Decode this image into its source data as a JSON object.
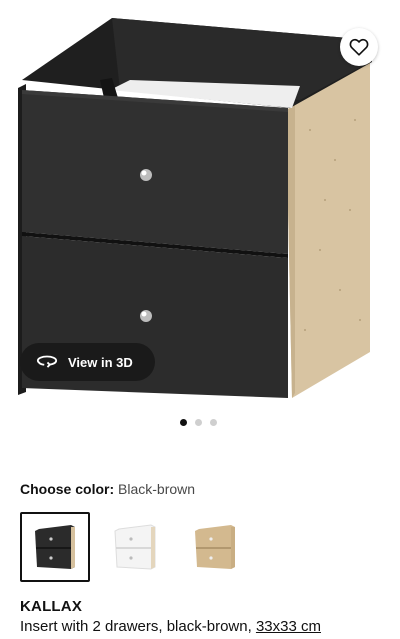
{
  "gallery": {
    "view_3d_label": "View in 3D",
    "dot_count": 3,
    "active_index": 0
  },
  "color_picker": {
    "label": "Choose color:",
    "selected_value": "Black-brown",
    "options": [
      {
        "name": "Black-brown",
        "selected": true
      },
      {
        "name": "White",
        "selected": false
      },
      {
        "name": "Oak effect",
        "selected": false
      }
    ]
  },
  "product": {
    "name": "KALLAX",
    "description": "Insert with 2 drawers, black-brown,",
    "size_link": "33x33 cm"
  },
  "icons": {
    "wishlist": "heart-icon",
    "view_3d": "rotate-3d-icon"
  },
  "colors": {
    "drawer_front": "#2e2e2e",
    "board_edge": "#d9c6a3",
    "pill_bg": "#1a1a1a"
  }
}
